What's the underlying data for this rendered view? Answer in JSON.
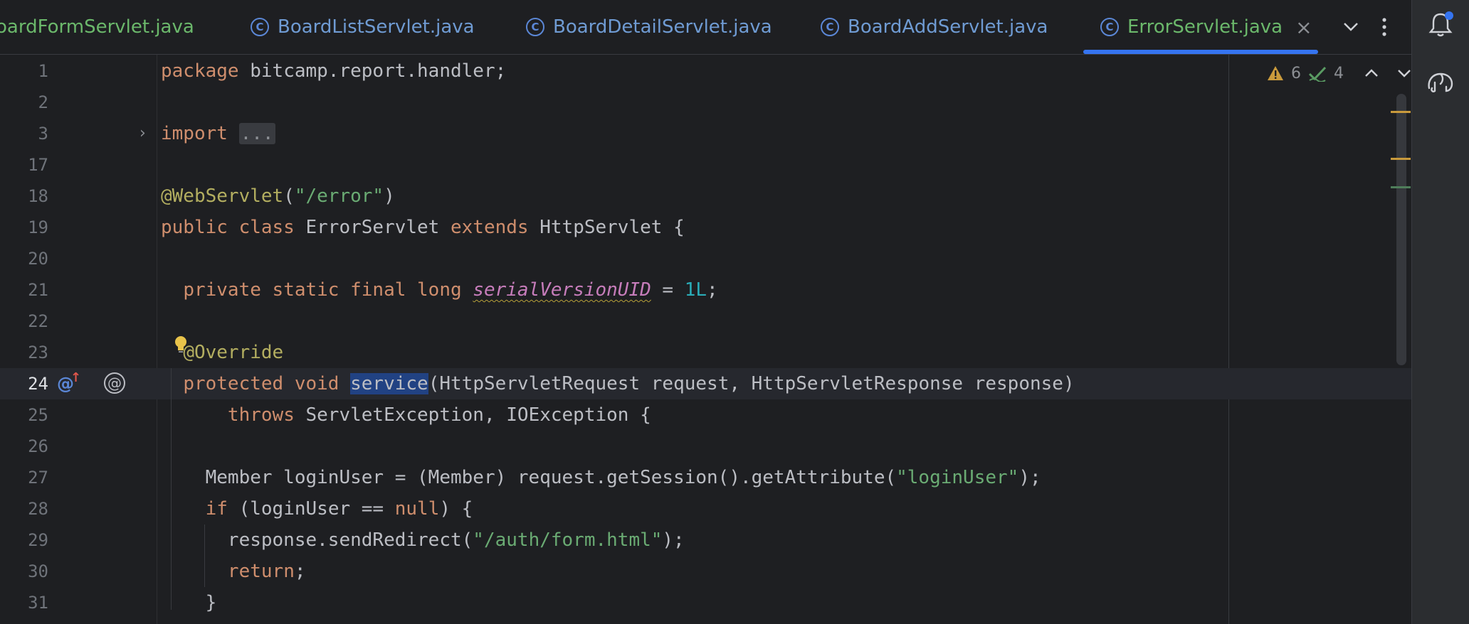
{
  "tabs": [
    {
      "label": "oardFormServlet.java",
      "icon": "",
      "state": "partial"
    },
    {
      "label": "BoardListServlet.java",
      "icon": "class-icon",
      "state": "inactive"
    },
    {
      "label": "BoardDetailServlet.java",
      "icon": "class-icon",
      "state": "inactive"
    },
    {
      "label": "BoardAddServlet.java",
      "icon": "class-icon",
      "state": "inactive"
    },
    {
      "label": "ErrorServlet.java",
      "icon": "class-icon",
      "state": "active"
    }
  ],
  "tab_icon_glyph": "C",
  "tab_close_glyph": "×",
  "tab_actions": {
    "dropdown": "⌄",
    "more": "⋮"
  },
  "inspections": {
    "warnings": "6",
    "ok": "4"
  },
  "gutter": {
    "override_glyph": "@",
    "impl_glyph": "@",
    "fold_glyph": "›"
  },
  "colors": {
    "background": "#1e1f22",
    "keyword": "#cf8e6d",
    "string": "#6aab73",
    "annotation": "#b3ae60",
    "number": "#2aacb8",
    "field": "#c77dbb",
    "active_tab_text": "#6bb86b",
    "active_tab_underline": "#3574f0",
    "selection": "#214283"
  },
  "lines": [
    {
      "num": "1",
      "tokens": [
        [
          "kw",
          "package"
        ],
        [
          "t",
          " bitcamp.report.handler;"
        ]
      ]
    },
    {
      "num": "2",
      "tokens": []
    },
    {
      "num": "3",
      "tokens": [
        [
          "kw",
          "import"
        ],
        [
          "t",
          " "
        ],
        [
          "fold",
          "..."
        ]
      ]
    },
    {
      "num": "17",
      "tokens": []
    },
    {
      "num": "18",
      "tokens": [
        [
          "ann",
          "@WebServlet"
        ],
        [
          "t",
          "("
        ],
        [
          "str",
          "\"/error\""
        ],
        [
          "t",
          ")"
        ]
      ]
    },
    {
      "num": "19",
      "tokens": [
        [
          "kw",
          "public class"
        ],
        [
          "t",
          " ErrorServlet "
        ],
        [
          "kw",
          "extends"
        ],
        [
          "t",
          " HttpServlet {"
        ]
      ]
    },
    {
      "num": "20",
      "tokens": []
    },
    {
      "num": "21",
      "tokens": [
        [
          "t",
          "  "
        ],
        [
          "kw",
          "private static final long"
        ],
        [
          "t",
          " "
        ],
        [
          "fld",
          "serialVersionUID"
        ],
        [
          "t",
          " = "
        ],
        [
          "num",
          "1L"
        ],
        [
          "t",
          ";"
        ]
      ]
    },
    {
      "num": "22",
      "tokens": []
    },
    {
      "num": "23",
      "tokens": [
        [
          "t",
          "  "
        ],
        [
          "ann",
          "@Override"
        ]
      ]
    },
    {
      "num": "24",
      "tokens": [
        [
          "t",
          "  "
        ],
        [
          "kw",
          "protected void"
        ],
        [
          "t",
          " "
        ],
        [
          "hl",
          "service"
        ],
        [
          "t",
          "(HttpServletRequest request, HttpServletResponse response)"
        ]
      ]
    },
    {
      "num": "25",
      "tokens": [
        [
          "t",
          "      "
        ],
        [
          "kw",
          "throws"
        ],
        [
          "t",
          " ServletException, IOException {"
        ]
      ]
    },
    {
      "num": "26",
      "tokens": []
    },
    {
      "num": "27",
      "tokens": [
        [
          "t",
          "    Member loginUser = (Member) request.getSession().getAttribute("
        ],
        [
          "str",
          "\"loginUser\""
        ],
        [
          "t",
          ");"
        ]
      ]
    },
    {
      "num": "28",
      "tokens": [
        [
          "t",
          "    "
        ],
        [
          "kw",
          "if"
        ],
        [
          "t",
          " (loginUser == "
        ],
        [
          "kw",
          "null"
        ],
        [
          "t",
          ") {"
        ]
      ]
    },
    {
      "num": "29",
      "tokens": [
        [
          "t",
          "      response.sendRedirect("
        ],
        [
          "str",
          "\"/auth/form.html\""
        ],
        [
          "t",
          ");"
        ]
      ]
    },
    {
      "num": "30",
      "tokens": [
        [
          "t",
          "      "
        ],
        [
          "kw",
          "return"
        ],
        [
          "t",
          ";"
        ]
      ]
    },
    {
      "num": "31",
      "tokens": [
        [
          "t",
          "    }"
        ]
      ]
    }
  ]
}
